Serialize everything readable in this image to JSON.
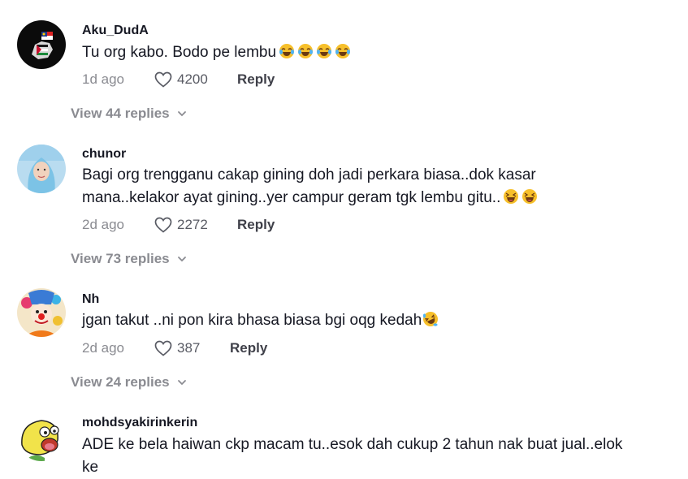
{
  "comments": [
    {
      "username": "Aku_DudA",
      "text": "Tu org kabo. Bodo pe lembu",
      "emojis": [
        "laughing-tears-emoji",
        "laughing-tears-emoji",
        "laughing-tears-emoji",
        "laughing-tears-emoji"
      ],
      "date": "1d ago",
      "likes": "4200",
      "reply_label": "Reply",
      "view_replies": "View 44 replies"
    },
    {
      "username": "chunor",
      "text": "Bagi org trengganu cakap gining doh jadi perkara biasa..dok kasar mana..kelakor ayat gining..yer campur geram tgk lembu gitu..",
      "emojis": [
        "squinting-laugh-emoji",
        "squinting-laugh-emoji"
      ],
      "date": "2d ago",
      "likes": "2272",
      "reply_label": "Reply",
      "view_replies": "View 73 replies"
    },
    {
      "username": "Nh",
      "text": "jgan takut ..ni pon kira bhasa biasa bgi oqg kedah",
      "emojis": [
        "rolling-laugh-emoji"
      ],
      "date": "2d ago",
      "likes": "387",
      "reply_label": "Reply",
      "view_replies": "View 24 replies"
    },
    {
      "username": "mohdsyakirinkerin",
      "text": "ADE ke bela haiwan ckp macam tu..esok dah cukup 2 tahun nak buat jual..elok ke"
    }
  ],
  "colors": {
    "text": "#161823",
    "muted": "#8a8b91",
    "reply": "#3f4049"
  }
}
